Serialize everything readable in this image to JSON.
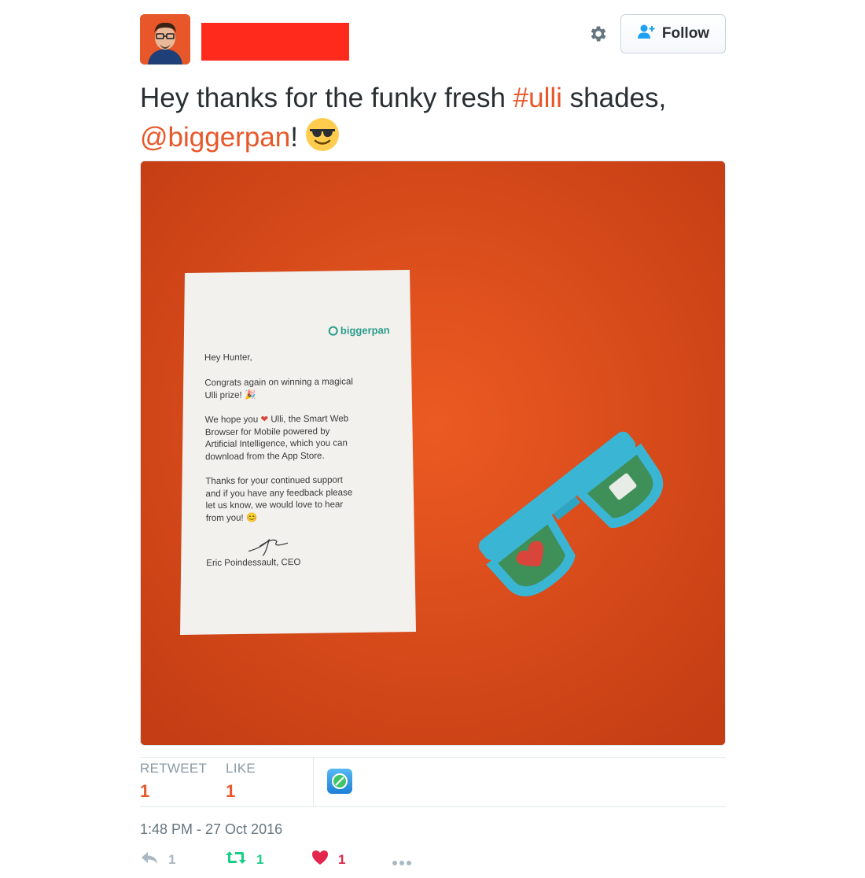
{
  "header": {
    "follow_label": "Follow"
  },
  "tweet": {
    "text_part1": "Hey thanks for the funky fresh ",
    "hashtag": "#ulli",
    "text_part2": " shades,",
    "mention": "@biggerpan",
    "text_part3": "!"
  },
  "letter": {
    "logo_text": "biggerpan",
    "greeting": "Hey Hunter,",
    "para1_line1": "Congrats again on winning a magical",
    "para1_line2": "Ulli prize!",
    "para2_line1": "We hope you",
    "para2_line1b": "Ulli, the Smart Web",
    "para2_line2": "Browser for Mobile powered by",
    "para2_line3": "Artificial Intelligence, which you can",
    "para2_line4": "download from the App Store.",
    "para3_line1": "Thanks for your continued support",
    "para3_line2": "and if you have any feedback please",
    "para3_line3": "let us know, we would love to hear",
    "para3_line4": "from you!",
    "signature_name": "Eric Poindessault, CEO"
  },
  "stats": {
    "retweet_label": "RETWEET",
    "retweet_count": "1",
    "like_label": "LIKE",
    "like_count": "1"
  },
  "timestamp": "1:48 PM - 27 Oct 2016",
  "actions": {
    "reply_count": "1",
    "retweet_count": "1",
    "like_count": "1"
  },
  "colors": {
    "link": "#e8572a",
    "retweet_green": "#19cf86",
    "like_red": "#e2264d",
    "muted": "#8899a6",
    "photo_background": "#e0531f",
    "glasses_frame": "#3ab5d4"
  },
  "icons": {
    "settings": "gear-icon",
    "follow": "add-user-icon",
    "emoji": "sunglasses-emoji-icon",
    "app": "app-avatar-icon",
    "reply": "reply-icon",
    "retweet": "retweet-icon",
    "like": "heart-icon",
    "more": "more-icon"
  }
}
